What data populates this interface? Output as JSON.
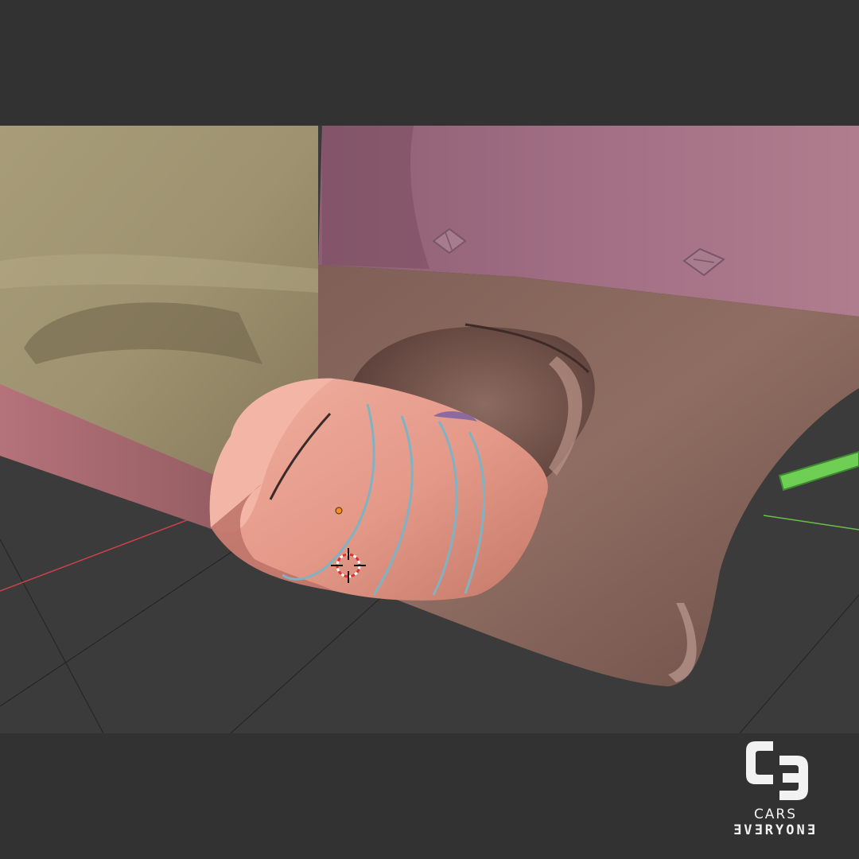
{
  "branding": {
    "name_line1": "CARS",
    "name_line2": "ƎVƎRYONƎ",
    "icon": "ce-monogram-icon"
  },
  "viewport": {
    "background_color": "#3b3b3b",
    "bar_color": "#323232",
    "x_axis_color": "#c8424a",
    "y_axis_color": "#6abf4b",
    "grid_color": "#262626",
    "scene": {
      "door_panel_color": "#a79a74",
      "rear_quarter_upper_color": "#9c6a7e",
      "rear_quarter_lower_color": "#8e6a5f",
      "exhaust_pipe_color": "#e5a090",
      "wire_color": "#7fb3c4",
      "selection_color": "#6fcf55",
      "origin_dot_color": "#ff8c1a",
      "icons": [
        "3d-cursor-icon",
        "object-origin-icon"
      ]
    }
  }
}
